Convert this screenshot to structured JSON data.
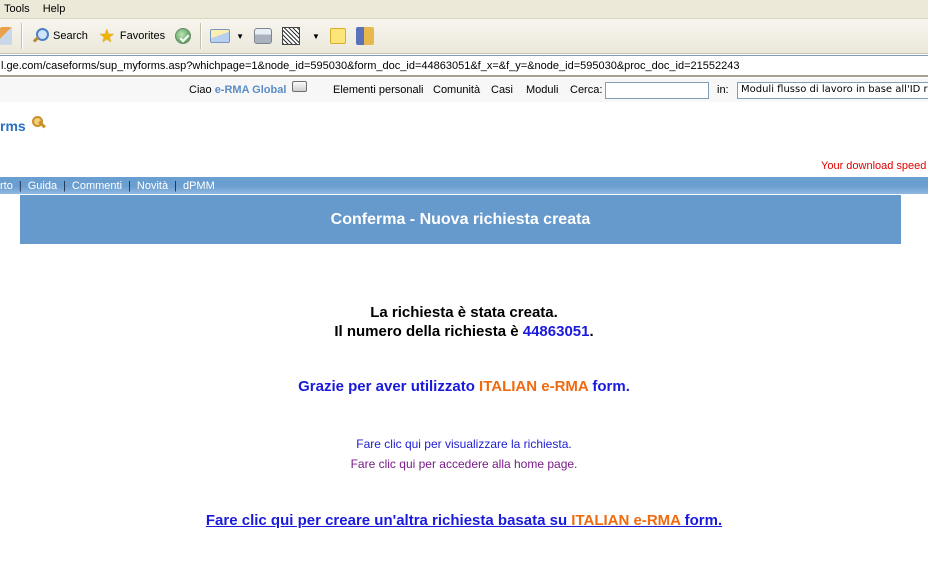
{
  "browser": {
    "menu": [
      "Tools",
      "Help"
    ],
    "toolbar": {
      "search_label": "Search",
      "favorites_label": "Favorites"
    },
    "address": "l.ge.com/caseforms/sup_myforms.asp?whichpage=1&node_id=595030&form_doc_id=44863051&f_x=&f_y=&node_id=595030&proc_doc_id=21552243"
  },
  "topnav": {
    "greeting_prefix": "Ciao ",
    "user": "e-RMA Global",
    "links": [
      "Elementi personali",
      "Comunità",
      "Casi",
      "Moduli"
    ],
    "search_label": "Cerca:",
    "search_value": "",
    "in_label": "in:",
    "scope_value": "Moduli flusso di lavoro in base all'ID richiesta"
  },
  "logo": {
    "text": "rms"
  },
  "download_speed": "Your download speed",
  "bluebar": {
    "items": [
      "rto",
      "Guida",
      "Commenti",
      "Novità",
      "dPMM"
    ],
    "separator": "|"
  },
  "confirm": {
    "title": "Conferma - Nuova richiesta creata",
    "line1": "La richiesta è stata creata.",
    "line2_prefix": "Il numero della richiesta è ",
    "request_number": "44863051",
    "line2_suffix": ".",
    "thanks_prefix": "Grazie per aver utilizzato ",
    "form_name": "ITALIAN e-RMA",
    "thanks_suffix": " form.",
    "link_view": "Fare clic qui per visualizzare la richiesta.",
    "link_home": "Fare clic qui per accedere alla home page.",
    "link_create_prefix": "Fare clic qui per creare un'altra richiesta basata su ",
    "link_create_form": "ITALIAN e-RMA",
    "link_create_suffix": " form."
  },
  "colors": {
    "header_blue": "#6699cc",
    "link_blue": "#1a1adc",
    "accent_orange": "#f06a10",
    "alert_red": "#e00000"
  }
}
